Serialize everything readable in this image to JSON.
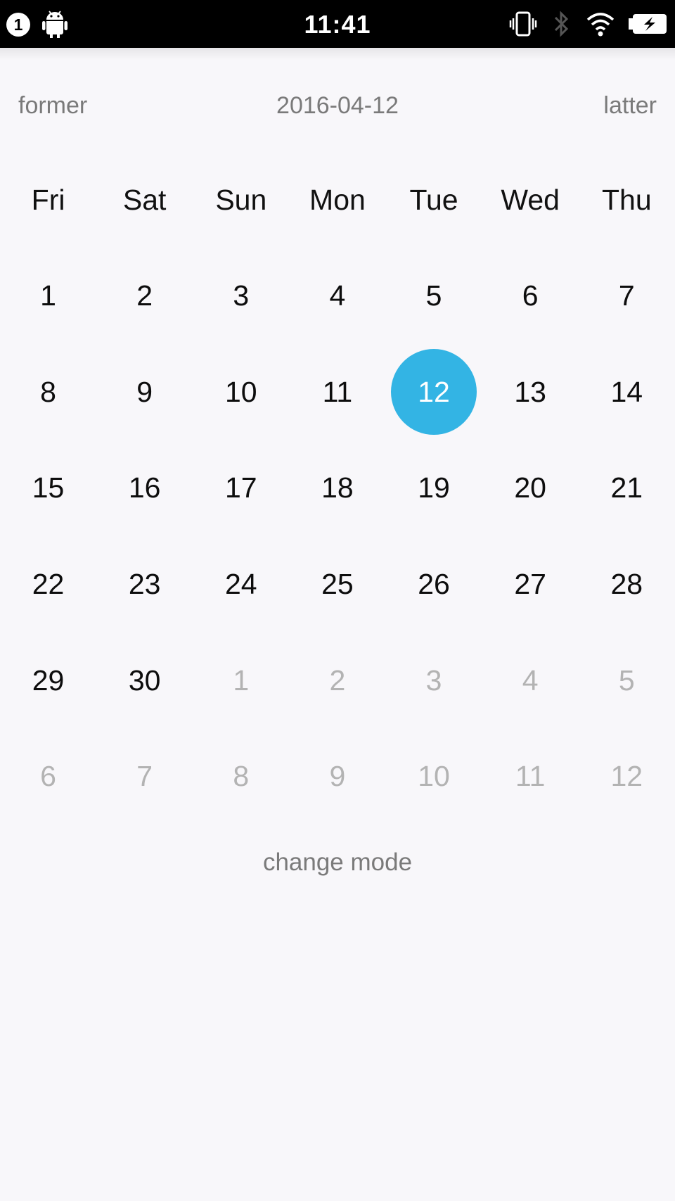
{
  "status_bar": {
    "notification_count": "1",
    "time": "11:41",
    "icons": [
      "android-icon",
      "vibrate-icon",
      "bluetooth-icon",
      "wifi-icon",
      "battery-charging-icon"
    ]
  },
  "nav": {
    "prev_label": "former",
    "current_date": "2016-04-12",
    "next_label": "latter"
  },
  "calendar": {
    "weekdays": [
      "Fri",
      "Sat",
      "Sun",
      "Mon",
      "Tue",
      "Wed",
      "Thu"
    ],
    "weeks": [
      [
        {
          "d": "1",
          "cur": true
        },
        {
          "d": "2",
          "cur": true
        },
        {
          "d": "3",
          "cur": true
        },
        {
          "d": "4",
          "cur": true
        },
        {
          "d": "5",
          "cur": true
        },
        {
          "d": "6",
          "cur": true
        },
        {
          "d": "7",
          "cur": true
        }
      ],
      [
        {
          "d": "8",
          "cur": true
        },
        {
          "d": "9",
          "cur": true
        },
        {
          "d": "10",
          "cur": true
        },
        {
          "d": "11",
          "cur": true
        },
        {
          "d": "12",
          "cur": true,
          "selected": true
        },
        {
          "d": "13",
          "cur": true
        },
        {
          "d": "14",
          "cur": true
        }
      ],
      [
        {
          "d": "15",
          "cur": true
        },
        {
          "d": "16",
          "cur": true
        },
        {
          "d": "17",
          "cur": true
        },
        {
          "d": "18",
          "cur": true
        },
        {
          "d": "19",
          "cur": true
        },
        {
          "d": "20",
          "cur": true
        },
        {
          "d": "21",
          "cur": true
        }
      ],
      [
        {
          "d": "22",
          "cur": true
        },
        {
          "d": "23",
          "cur": true
        },
        {
          "d": "24",
          "cur": true
        },
        {
          "d": "25",
          "cur": true
        },
        {
          "d": "26",
          "cur": true
        },
        {
          "d": "27",
          "cur": true
        },
        {
          "d": "28",
          "cur": true
        }
      ],
      [
        {
          "d": "29",
          "cur": true
        },
        {
          "d": "30",
          "cur": true
        },
        {
          "d": "1",
          "cur": false
        },
        {
          "d": "2",
          "cur": false
        },
        {
          "d": "3",
          "cur": false
        },
        {
          "d": "4",
          "cur": false
        },
        {
          "d": "5",
          "cur": false
        }
      ],
      [
        {
          "d": "6",
          "cur": false
        },
        {
          "d": "7",
          "cur": false
        },
        {
          "d": "8",
          "cur": false
        },
        {
          "d": "9",
          "cur": false
        },
        {
          "d": "10",
          "cur": false
        },
        {
          "d": "11",
          "cur": false
        },
        {
          "d": "12",
          "cur": false
        }
      ]
    ],
    "selected_color": "#33b4e4",
    "other_month_color": "#b3b3b3"
  },
  "footer": {
    "change_mode_label": "change mode"
  }
}
